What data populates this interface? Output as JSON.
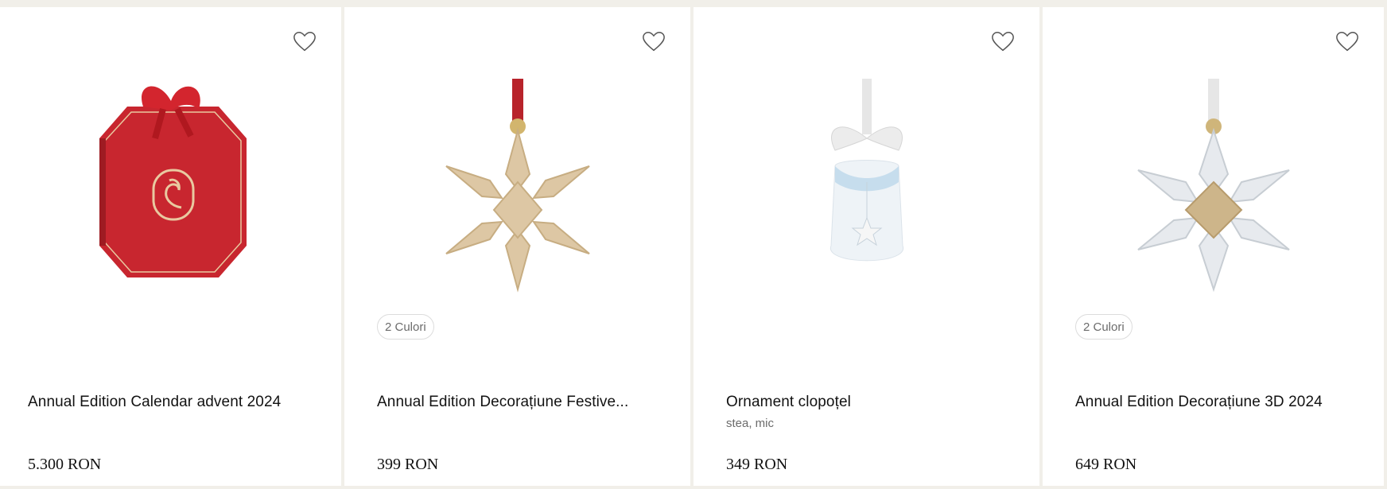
{
  "products": [
    {
      "title": "Annual Edition Calendar advent 2024",
      "subtitle": "",
      "colors_badge": "",
      "price": "5.300 RON",
      "image": "advent-calendar"
    },
    {
      "title": "Annual Edition Decorațiune Festive...",
      "subtitle": "",
      "colors_badge": "2 Culori",
      "price": "399 RON",
      "image": "gold-snowflake-ornament"
    },
    {
      "title": "Ornament clopoțel",
      "subtitle": "stea, mic",
      "colors_badge": "",
      "price": "349 RON",
      "image": "bell-ornament"
    },
    {
      "title": "Annual Edition Decorațiune 3D 2024",
      "subtitle": "",
      "colors_badge": "2 Culori",
      "price": "649 RON",
      "image": "3d-snowflake-ornament"
    }
  ],
  "icons": {
    "wishlist": "heart-outline-icon"
  },
  "colors": {
    "page_bg": "#f1efe9",
    "card_bg": "#ffffff",
    "calendar_red": "#c8262f",
    "gold": "#c9b48d"
  }
}
